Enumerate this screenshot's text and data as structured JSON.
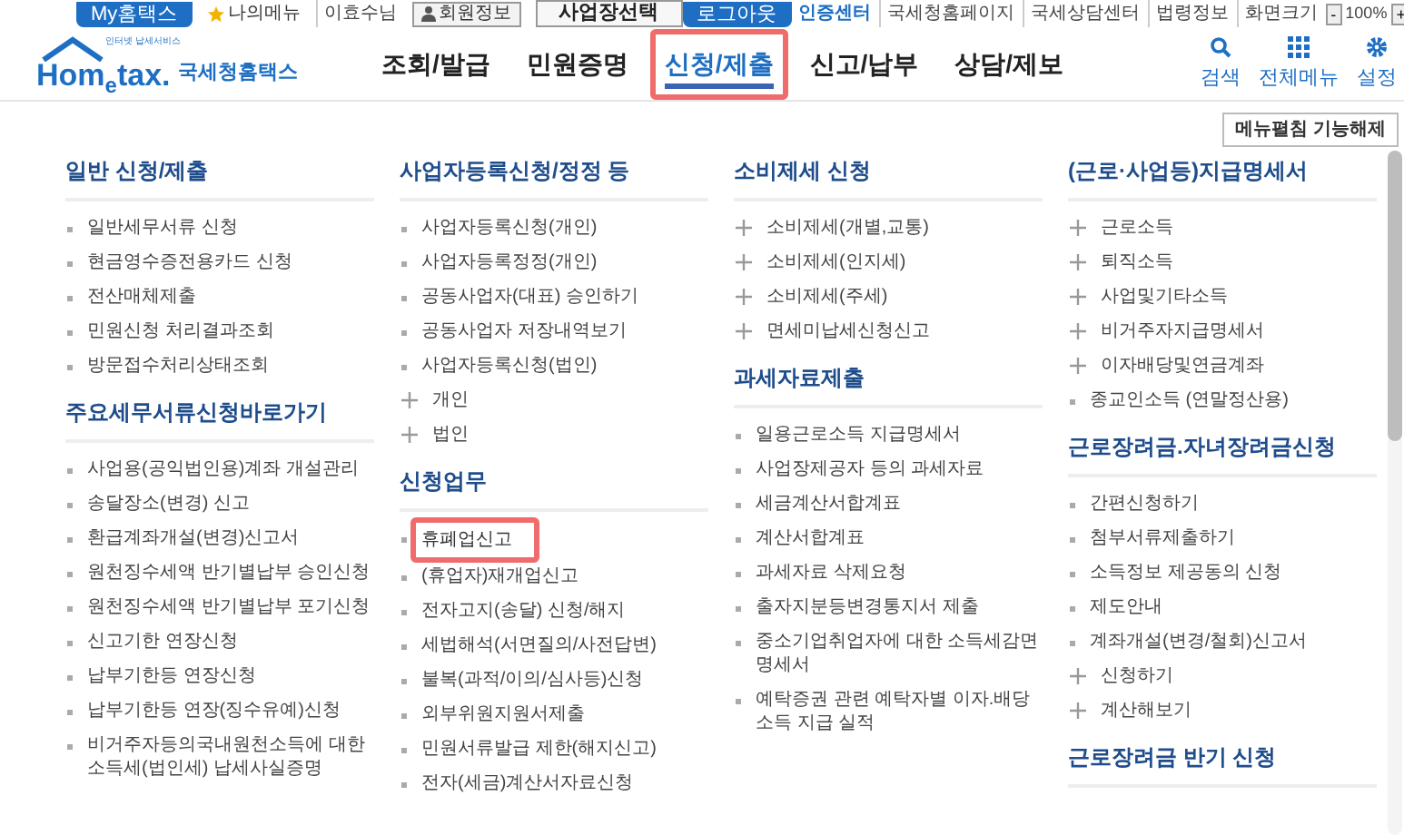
{
  "top_bar": {
    "left": [
      {
        "label": "My홈택스",
        "kind": "brand"
      },
      {
        "label": "나의메뉴",
        "kind": "star"
      },
      {
        "label": "이효수님",
        "kind": "text"
      },
      {
        "label": "회원정보",
        "kind": "user_button"
      },
      {
        "label": "사업장선택",
        "kind": "button"
      }
    ],
    "right": [
      {
        "label": "로그아웃",
        "kind": "brand"
      },
      {
        "label": "인증센터",
        "kind": "strong"
      },
      {
        "label": "국세청홈페이지",
        "kind": "text"
      },
      {
        "label": "국세상담센터",
        "kind": "text"
      },
      {
        "label": "법령정보",
        "kind": "text"
      },
      {
        "label": "화면크기",
        "kind": "text"
      }
    ],
    "zoom": {
      "minus": "-",
      "value": "100%",
      "plus": "+"
    }
  },
  "logo": {
    "tagline": "인터넷 납세서비스",
    "name_left": "Hom",
    "name_mid": "e",
    "name_right": "tax.",
    "subtitle": "국세청홈택스"
  },
  "nav": [
    {
      "label": "조회/발급",
      "selected": false
    },
    {
      "label": "민원증명",
      "selected": false
    },
    {
      "label": "신청/제출",
      "selected": true
    },
    {
      "label": "신고/납부",
      "selected": false
    },
    {
      "label": "상담/제보",
      "selected": false
    }
  ],
  "tools": [
    {
      "label": "검색",
      "kind": "search"
    },
    {
      "label": "전체메뉴",
      "kind": "grid"
    },
    {
      "label": "설정",
      "kind": "gear"
    }
  ],
  "collapse_button": "메뉴펼침 기능해제",
  "columns": [
    [
      {
        "title": "일반 신청/제출",
        "items": [
          {
            "label": "일반세무서류 신청",
            "kind": "bullet",
            "highlighted": false
          },
          {
            "label": "현금영수증전용카드 신청",
            "kind": "bullet",
            "highlighted": false
          },
          {
            "label": "전산매체제출",
            "kind": "bullet",
            "highlighted": false
          },
          {
            "label": "민원신청 처리결과조회",
            "kind": "bullet",
            "highlighted": false
          },
          {
            "label": "방문접수처리상태조회",
            "kind": "bullet",
            "highlighted": false
          }
        ]
      },
      {
        "title": "주요세무서류신청바로가기",
        "items": [
          {
            "label": "사업용(공익법인용)계좌 개설관리",
            "kind": "bullet",
            "highlighted": false
          },
          {
            "label": "송달장소(변경) 신고",
            "kind": "bullet",
            "highlighted": false
          },
          {
            "label": "환급계좌개설(변경)신고서",
            "kind": "bullet",
            "highlighted": false
          },
          {
            "label": "원천징수세액 반기별납부 승인신청",
            "kind": "bullet",
            "highlighted": false
          },
          {
            "label": "원천징수세액 반기별납부 포기신청",
            "kind": "bullet",
            "highlighted": false
          },
          {
            "label": "신고기한 연장신청",
            "kind": "bullet",
            "highlighted": false
          },
          {
            "label": "납부기한등 연장신청",
            "kind": "bullet",
            "highlighted": false
          },
          {
            "label": "납부기한등 연장(징수유예)신청",
            "kind": "bullet",
            "highlighted": false
          },
          {
            "label": "비거주자등의국내원천소득에 대한 소득세(법인세) 납세사실증명",
            "kind": "bullet",
            "highlighted": false
          }
        ]
      }
    ],
    [
      {
        "title": "사업자등록신청/정정 등",
        "items": [
          {
            "label": "사업자등록신청(개인)",
            "kind": "bullet",
            "highlighted": false
          },
          {
            "label": "사업자등록정정(개인)",
            "kind": "bullet",
            "highlighted": false
          },
          {
            "label": "공동사업자(대표) 승인하기",
            "kind": "bullet",
            "highlighted": false
          },
          {
            "label": "공동사업자 저장내역보기",
            "kind": "bullet",
            "highlighted": false
          },
          {
            "label": "사업자등록신청(법인)",
            "kind": "bullet",
            "highlighted": false
          },
          {
            "label": "개인",
            "kind": "plus",
            "highlighted": false
          },
          {
            "label": "법인",
            "kind": "plus",
            "highlighted": false
          }
        ]
      },
      {
        "title": "신청업무",
        "items": [
          {
            "label": "휴폐업신고",
            "kind": "bullet",
            "highlighted": true
          },
          {
            "label": "(휴업자)재개업신고",
            "kind": "bullet",
            "highlighted": false
          },
          {
            "label": "전자고지(송달) 신청/해지",
            "kind": "bullet",
            "highlighted": false
          },
          {
            "label": "세법해석(서면질의/사전답변)",
            "kind": "bullet",
            "highlighted": false
          },
          {
            "label": "불복(과적/이의/심사등)신청",
            "kind": "bullet",
            "highlighted": false
          },
          {
            "label": "외부위원지원서제출",
            "kind": "bullet",
            "highlighted": false
          },
          {
            "label": "민원서류발급 제한(해지신고)",
            "kind": "bullet",
            "highlighted": false
          },
          {
            "label": "전자(세금)계산서자료신청",
            "kind": "bullet",
            "highlighted": false
          }
        ]
      }
    ],
    [
      {
        "title": "소비제세 신청",
        "items": [
          {
            "label": "소비제세(개별,교통)",
            "kind": "plus",
            "highlighted": false
          },
          {
            "label": "소비제세(인지세)",
            "kind": "plus",
            "highlighted": false
          },
          {
            "label": "소비제세(주세)",
            "kind": "plus",
            "highlighted": false
          },
          {
            "label": "면세미납세신청신고",
            "kind": "plus",
            "highlighted": false
          }
        ]
      },
      {
        "title": "과세자료제출",
        "items": [
          {
            "label": "일용근로소득 지급명세서",
            "kind": "bullet",
            "highlighted": false
          },
          {
            "label": "사업장제공자 등의 과세자료",
            "kind": "bullet",
            "highlighted": false
          },
          {
            "label": "세금계산서합계표",
            "kind": "bullet",
            "highlighted": false
          },
          {
            "label": "계산서합계표",
            "kind": "bullet",
            "highlighted": false
          },
          {
            "label": "과세자료 삭제요청",
            "kind": "bullet",
            "highlighted": false
          },
          {
            "label": "출자지분등변경통지서 제출",
            "kind": "bullet",
            "highlighted": false
          },
          {
            "label": "중소기업취업자에 대한 소득세감면명세서",
            "kind": "bullet",
            "highlighted": false
          },
          {
            "label": "예탁증권 관련 예탁자별 이자.배당소득 지급 실적",
            "kind": "bullet",
            "highlighted": false
          }
        ]
      }
    ],
    [
      {
        "title": "(근로·사업등)지급명세서",
        "items": [
          {
            "label": "근로소득",
            "kind": "plus",
            "highlighted": false
          },
          {
            "label": "퇴직소득",
            "kind": "plus",
            "highlighted": false
          },
          {
            "label": "사업및기타소득",
            "kind": "plus",
            "highlighted": false
          },
          {
            "label": "비거주자지급명세서",
            "kind": "plus",
            "highlighted": false
          },
          {
            "label": "이자배당및연금계좌",
            "kind": "plus",
            "highlighted": false
          },
          {
            "label": "종교인소득 (연말정산용)",
            "kind": "bullet",
            "highlighted": false
          }
        ]
      },
      {
        "title": "근로장려금.자녀장려금신청",
        "items": [
          {
            "label": "간편신청하기",
            "kind": "bullet",
            "highlighted": false
          },
          {
            "label": "첨부서류제출하기",
            "kind": "bullet",
            "highlighted": false
          },
          {
            "label": "소득정보 제공동의 신청",
            "kind": "bullet",
            "highlighted": false
          },
          {
            "label": "제도안내",
            "kind": "bullet",
            "highlighted": false
          },
          {
            "label": "계좌개설(변경/철회)신고서",
            "kind": "bullet",
            "highlighted": false
          },
          {
            "label": "신청하기",
            "kind": "plus",
            "highlighted": false
          },
          {
            "label": "계산해보기",
            "kind": "plus",
            "highlighted": false
          }
        ]
      },
      {
        "title": "근로장려금 반기 신청"
      }
    ]
  ]
}
